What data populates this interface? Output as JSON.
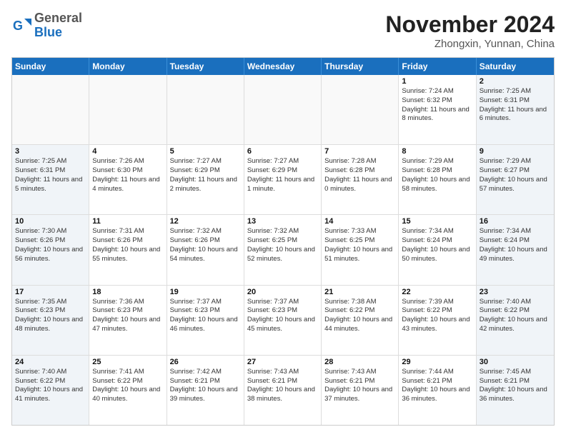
{
  "logo": {
    "general": "General",
    "blue": "Blue"
  },
  "title": "November 2024",
  "subtitle": "Zhongxin, Yunnan, China",
  "days_of_week": [
    "Sunday",
    "Monday",
    "Tuesday",
    "Wednesday",
    "Thursday",
    "Friday",
    "Saturday"
  ],
  "weeks": [
    [
      {
        "day": "",
        "info": ""
      },
      {
        "day": "",
        "info": ""
      },
      {
        "day": "",
        "info": ""
      },
      {
        "day": "",
        "info": ""
      },
      {
        "day": "",
        "info": ""
      },
      {
        "day": "1",
        "info": "Sunrise: 7:24 AM\nSunset: 6:32 PM\nDaylight: 11 hours and 8 minutes."
      },
      {
        "day": "2",
        "info": "Sunrise: 7:25 AM\nSunset: 6:31 PM\nDaylight: 11 hours and 6 minutes."
      }
    ],
    [
      {
        "day": "3",
        "info": "Sunrise: 7:25 AM\nSunset: 6:31 PM\nDaylight: 11 hours and 5 minutes."
      },
      {
        "day": "4",
        "info": "Sunrise: 7:26 AM\nSunset: 6:30 PM\nDaylight: 11 hours and 4 minutes."
      },
      {
        "day": "5",
        "info": "Sunrise: 7:27 AM\nSunset: 6:29 PM\nDaylight: 11 hours and 2 minutes."
      },
      {
        "day": "6",
        "info": "Sunrise: 7:27 AM\nSunset: 6:29 PM\nDaylight: 11 hours and 1 minute."
      },
      {
        "day": "7",
        "info": "Sunrise: 7:28 AM\nSunset: 6:28 PM\nDaylight: 11 hours and 0 minutes."
      },
      {
        "day": "8",
        "info": "Sunrise: 7:29 AM\nSunset: 6:28 PM\nDaylight: 10 hours and 58 minutes."
      },
      {
        "day": "9",
        "info": "Sunrise: 7:29 AM\nSunset: 6:27 PM\nDaylight: 10 hours and 57 minutes."
      }
    ],
    [
      {
        "day": "10",
        "info": "Sunrise: 7:30 AM\nSunset: 6:26 PM\nDaylight: 10 hours and 56 minutes."
      },
      {
        "day": "11",
        "info": "Sunrise: 7:31 AM\nSunset: 6:26 PM\nDaylight: 10 hours and 55 minutes."
      },
      {
        "day": "12",
        "info": "Sunrise: 7:32 AM\nSunset: 6:26 PM\nDaylight: 10 hours and 54 minutes."
      },
      {
        "day": "13",
        "info": "Sunrise: 7:32 AM\nSunset: 6:25 PM\nDaylight: 10 hours and 52 minutes."
      },
      {
        "day": "14",
        "info": "Sunrise: 7:33 AM\nSunset: 6:25 PM\nDaylight: 10 hours and 51 minutes."
      },
      {
        "day": "15",
        "info": "Sunrise: 7:34 AM\nSunset: 6:24 PM\nDaylight: 10 hours and 50 minutes."
      },
      {
        "day": "16",
        "info": "Sunrise: 7:34 AM\nSunset: 6:24 PM\nDaylight: 10 hours and 49 minutes."
      }
    ],
    [
      {
        "day": "17",
        "info": "Sunrise: 7:35 AM\nSunset: 6:23 PM\nDaylight: 10 hours and 48 minutes."
      },
      {
        "day": "18",
        "info": "Sunrise: 7:36 AM\nSunset: 6:23 PM\nDaylight: 10 hours and 47 minutes."
      },
      {
        "day": "19",
        "info": "Sunrise: 7:37 AM\nSunset: 6:23 PM\nDaylight: 10 hours and 46 minutes."
      },
      {
        "day": "20",
        "info": "Sunrise: 7:37 AM\nSunset: 6:23 PM\nDaylight: 10 hours and 45 minutes."
      },
      {
        "day": "21",
        "info": "Sunrise: 7:38 AM\nSunset: 6:22 PM\nDaylight: 10 hours and 44 minutes."
      },
      {
        "day": "22",
        "info": "Sunrise: 7:39 AM\nSunset: 6:22 PM\nDaylight: 10 hours and 43 minutes."
      },
      {
        "day": "23",
        "info": "Sunrise: 7:40 AM\nSunset: 6:22 PM\nDaylight: 10 hours and 42 minutes."
      }
    ],
    [
      {
        "day": "24",
        "info": "Sunrise: 7:40 AM\nSunset: 6:22 PM\nDaylight: 10 hours and 41 minutes."
      },
      {
        "day": "25",
        "info": "Sunrise: 7:41 AM\nSunset: 6:22 PM\nDaylight: 10 hours and 40 minutes."
      },
      {
        "day": "26",
        "info": "Sunrise: 7:42 AM\nSunset: 6:21 PM\nDaylight: 10 hours and 39 minutes."
      },
      {
        "day": "27",
        "info": "Sunrise: 7:43 AM\nSunset: 6:21 PM\nDaylight: 10 hours and 38 minutes."
      },
      {
        "day": "28",
        "info": "Sunrise: 7:43 AM\nSunset: 6:21 PM\nDaylight: 10 hours and 37 minutes."
      },
      {
        "day": "29",
        "info": "Sunrise: 7:44 AM\nSunset: 6:21 PM\nDaylight: 10 hours and 36 minutes."
      },
      {
        "day": "30",
        "info": "Sunrise: 7:45 AM\nSunset: 6:21 PM\nDaylight: 10 hours and 36 minutes."
      }
    ]
  ]
}
